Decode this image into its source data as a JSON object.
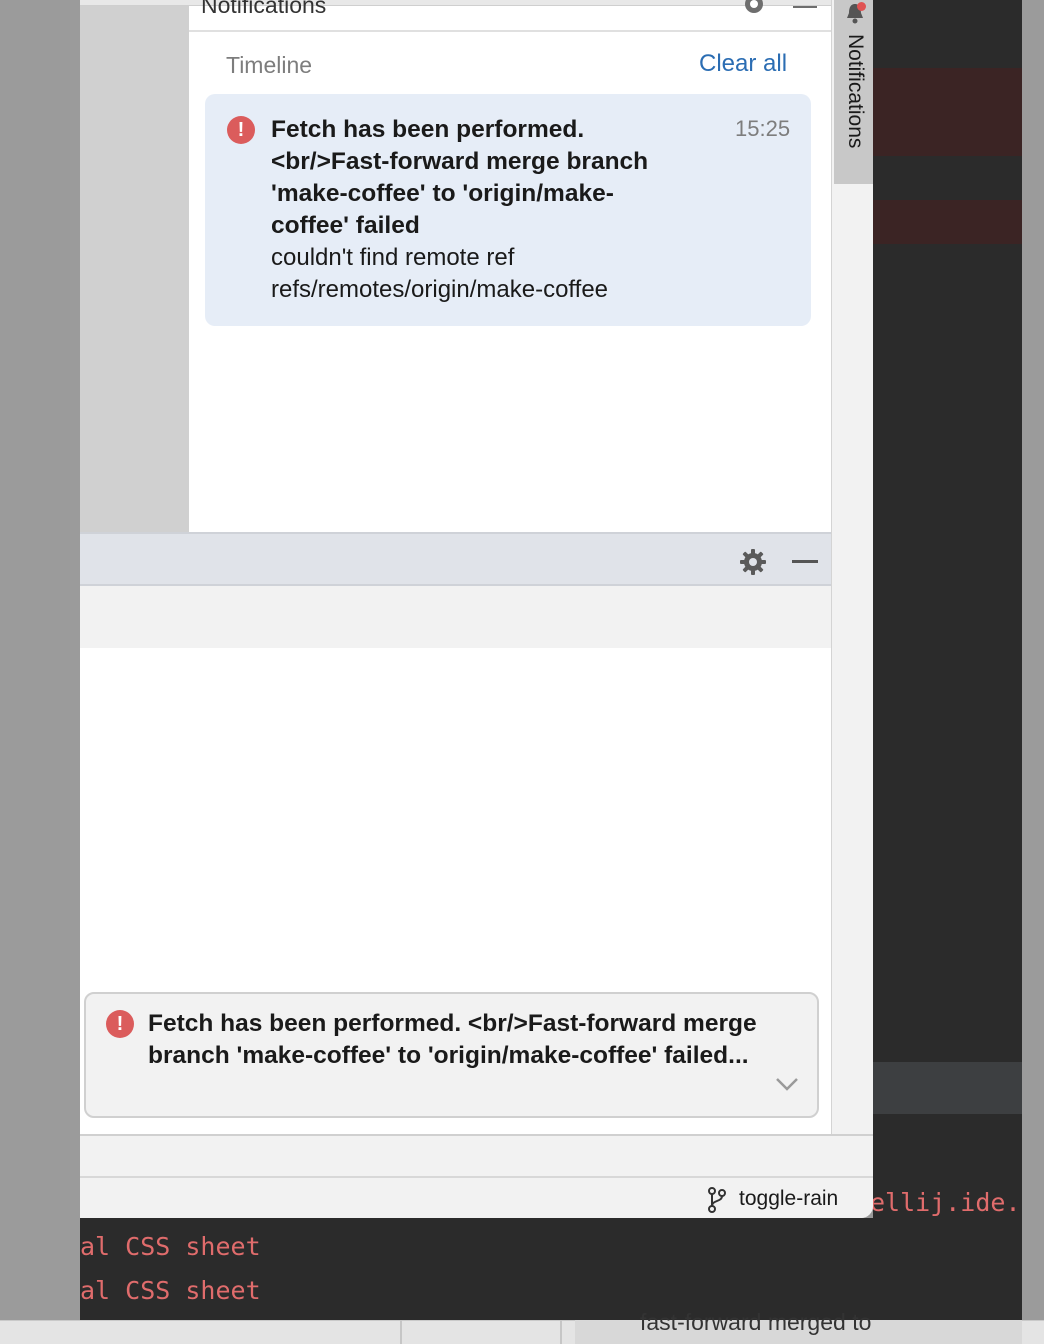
{
  "notifications_panel": {
    "title": "Notifications",
    "timeline_label": "Timeline",
    "clear_all_label": "Clear all",
    "notification": {
      "title": "Fetch has been performed. <br/>Fast-forward merge branch 'make-coffee' to 'origin/make-coffee' failed",
      "body": "couldn't find remote ref refs/remotes/origin/make-coffee",
      "time": "15:25",
      "icon": "error-icon"
    }
  },
  "side_strip": {
    "label": "Notifications",
    "icon": "bell-icon"
  },
  "balloon": {
    "text": "Fetch has been performed. <br/>Fast-forward merge branch 'make-coffee' to 'origin/make-coffee' failed...",
    "icon": "error-icon"
  },
  "status_bar": {
    "branch": "toggle-rain"
  },
  "background_editor": {
    "line1": "al CSS sheet",
    "line2": "al CSS sheet",
    "right_fragment": "ellij.ide.",
    "bottom_fragment": "fast-forward merged to"
  },
  "colors": {
    "accent_link": "#2b6db3",
    "error": "#db5c5c",
    "card_bg": "#e6edf7"
  }
}
